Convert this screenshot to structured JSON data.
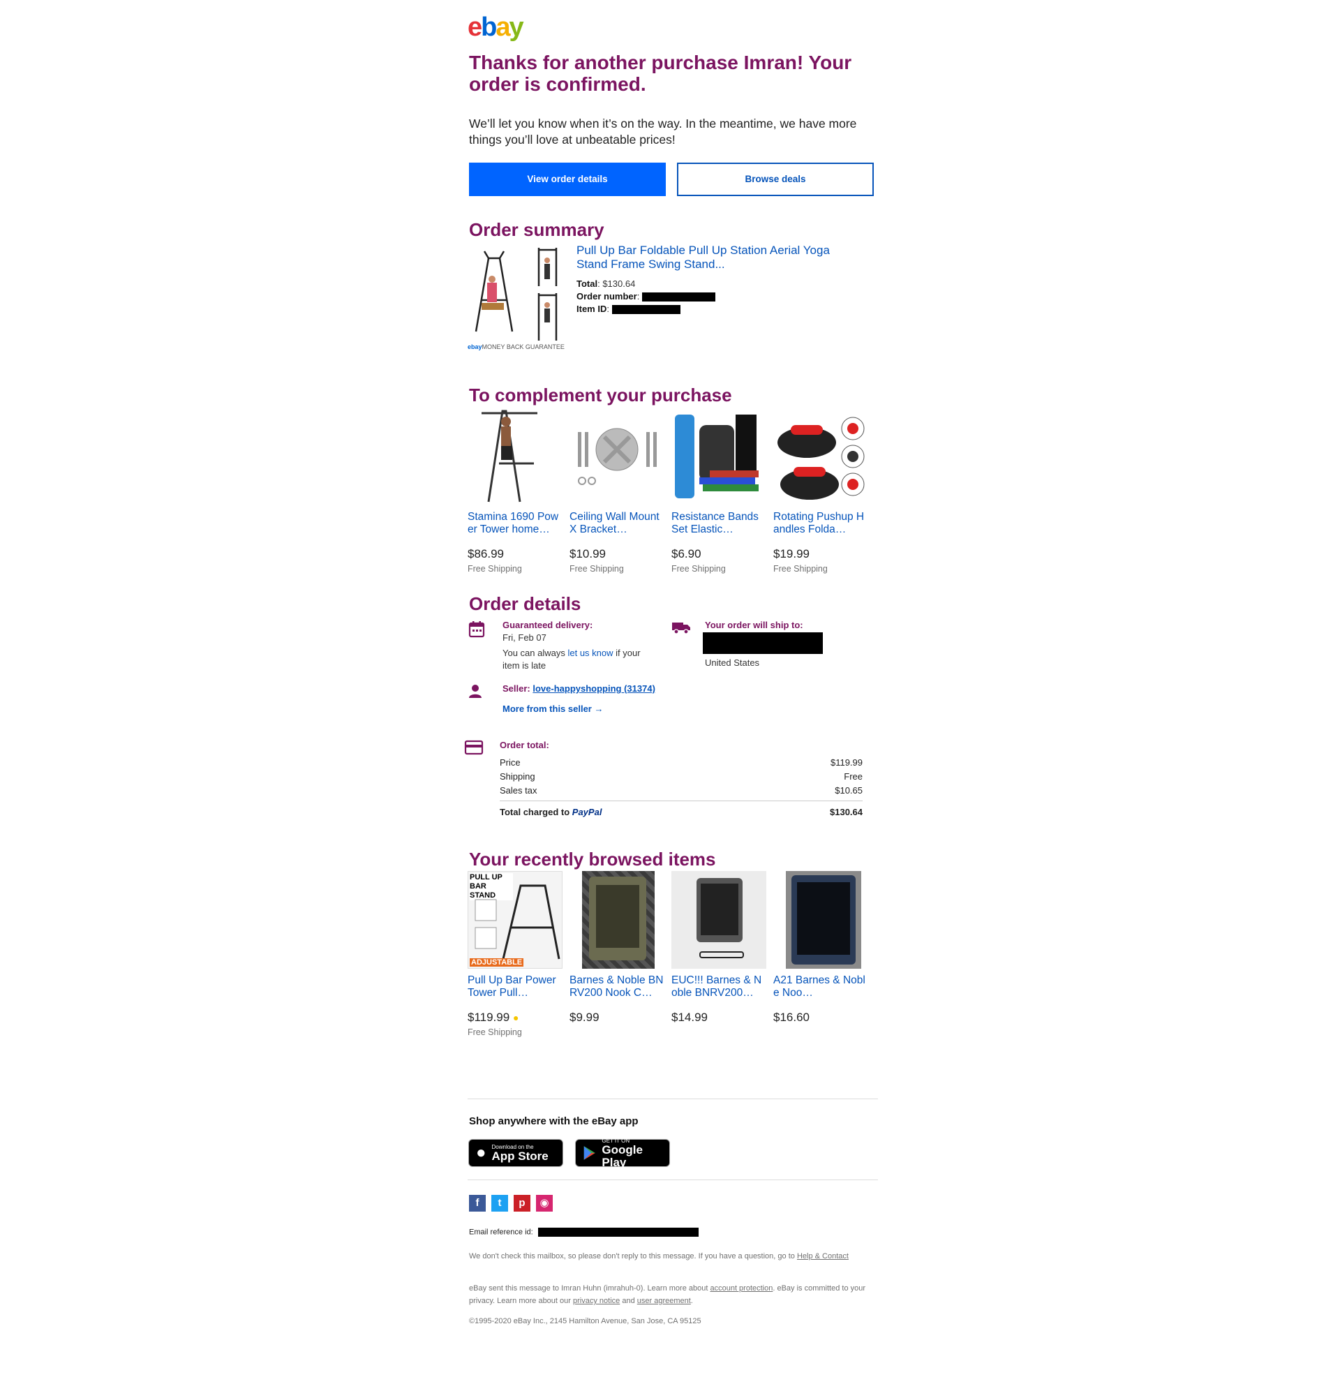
{
  "brand": {
    "logo_text": "ebay",
    "accent": "#7b1460",
    "link": "#0654ba",
    "primary": "#0064ff"
  },
  "header": {
    "headline": "Thanks for another purchase Imran! Your order is confirmed.",
    "intro": "We’ll let you know when it’s on the way. In the meantime, we have more things you’ll love at unbeatable prices!",
    "view_order_label": "View order details",
    "browse_deals_label": "Browse deals"
  },
  "order_summary": {
    "heading": "Order summary",
    "item_title": "Pull Up Bar Foldable Pull Up Station Aerial Yoga Stand Frame Swing Stand...",
    "total_label": "Total",
    "total_value": "$130.64",
    "order_number_label": "Order number",
    "item_id_label": "Item ID",
    "guarantee_logo": "ebay",
    "guarantee_text": "MONEY BACK GUARANTEE"
  },
  "complement": {
    "heading": "To complement your purchase",
    "items": [
      {
        "title": "Stamina 1690 Power Tower home…",
        "price": "$86.99",
        "shipping": "Free Shipping"
      },
      {
        "title": "Ceiling Wall Mount X Bracket…",
        "price": "$10.99",
        "shipping": "Free Shipping"
      },
      {
        "title": "Resistance Bands Set Elastic…",
        "price": "$6.90",
        "shipping": "Free Shipping"
      },
      {
        "title": "Rotating Pushup Handles Folda…",
        "price": "$19.99",
        "shipping": "Free Shipping"
      }
    ]
  },
  "order_details": {
    "heading": "Order details",
    "delivery_label": "Guaranteed delivery:",
    "delivery_date": "Fri, Feb 07",
    "late_pre": "You can always",
    "late_link": "let us know",
    "late_post": "if your item is late",
    "ship_to_label": "Your order will ship to:",
    "ship_country": "United States",
    "seller_label": "Seller:",
    "seller_name": "love-happyshopping (31374)",
    "more_from_seller": "More from this seller",
    "order_total_label": "Order total:",
    "lines": [
      {
        "label": "Price",
        "value": "$119.99"
      },
      {
        "label": "Shipping",
        "value": "Free"
      },
      {
        "label": "Sales tax",
        "value": "$10.65"
      }
    ],
    "total_charged_label": "Total charged to",
    "payment_brand": "PayPal",
    "total_charged_value": "$130.64"
  },
  "recent": {
    "heading": "Your recently browsed items",
    "items": [
      {
        "title": "Pull Up Bar Power Tower Pull…",
        "price": "$119.99",
        "shipping": "Free Shipping",
        "img_text_top": "PULL UP BAR STAND",
        "img_text_bottom": "ADJUSTABLE"
      },
      {
        "title": "Barnes & Noble BNRV200 Nook C…",
        "price": "$9.99",
        "shipping": ""
      },
      {
        "title": "EUC!!! Barnes & Noble BNRV200…",
        "price": "$14.99",
        "shipping": ""
      },
      {
        "title": "A21 Barnes & Noble Noo…",
        "price": "$16.60",
        "shipping": ""
      }
    ]
  },
  "footer": {
    "app_heading": "Shop anywhere with the eBay app",
    "appstore_small": "Download on the",
    "appstore_big": "App Store",
    "googleplay_small": "GET IT ON",
    "googleplay_big": "Google Play",
    "email_ref_label": "Email reference id:",
    "no_reply_pre": "We don't check this mailbox, so please don't reply to this message. If you have a question, go to",
    "help_link": "Help & Contact",
    "sent_pre": "eBay sent this message to Imran Huhn (imrahuh-0). Learn more about",
    "account_protection": "account protection",
    "sent_mid": ". eBay is committed to your privacy. Learn more about our",
    "privacy_notice": "privacy notice",
    "and": "and",
    "user_agreement": "user agreement",
    "copyright": "©1995-2020 eBay Inc., 2145 Hamilton Avenue, San Jose, CA 95125",
    "social": [
      "facebook-icon",
      "twitter-icon",
      "pinterest-icon",
      "instagram-icon"
    ]
  }
}
